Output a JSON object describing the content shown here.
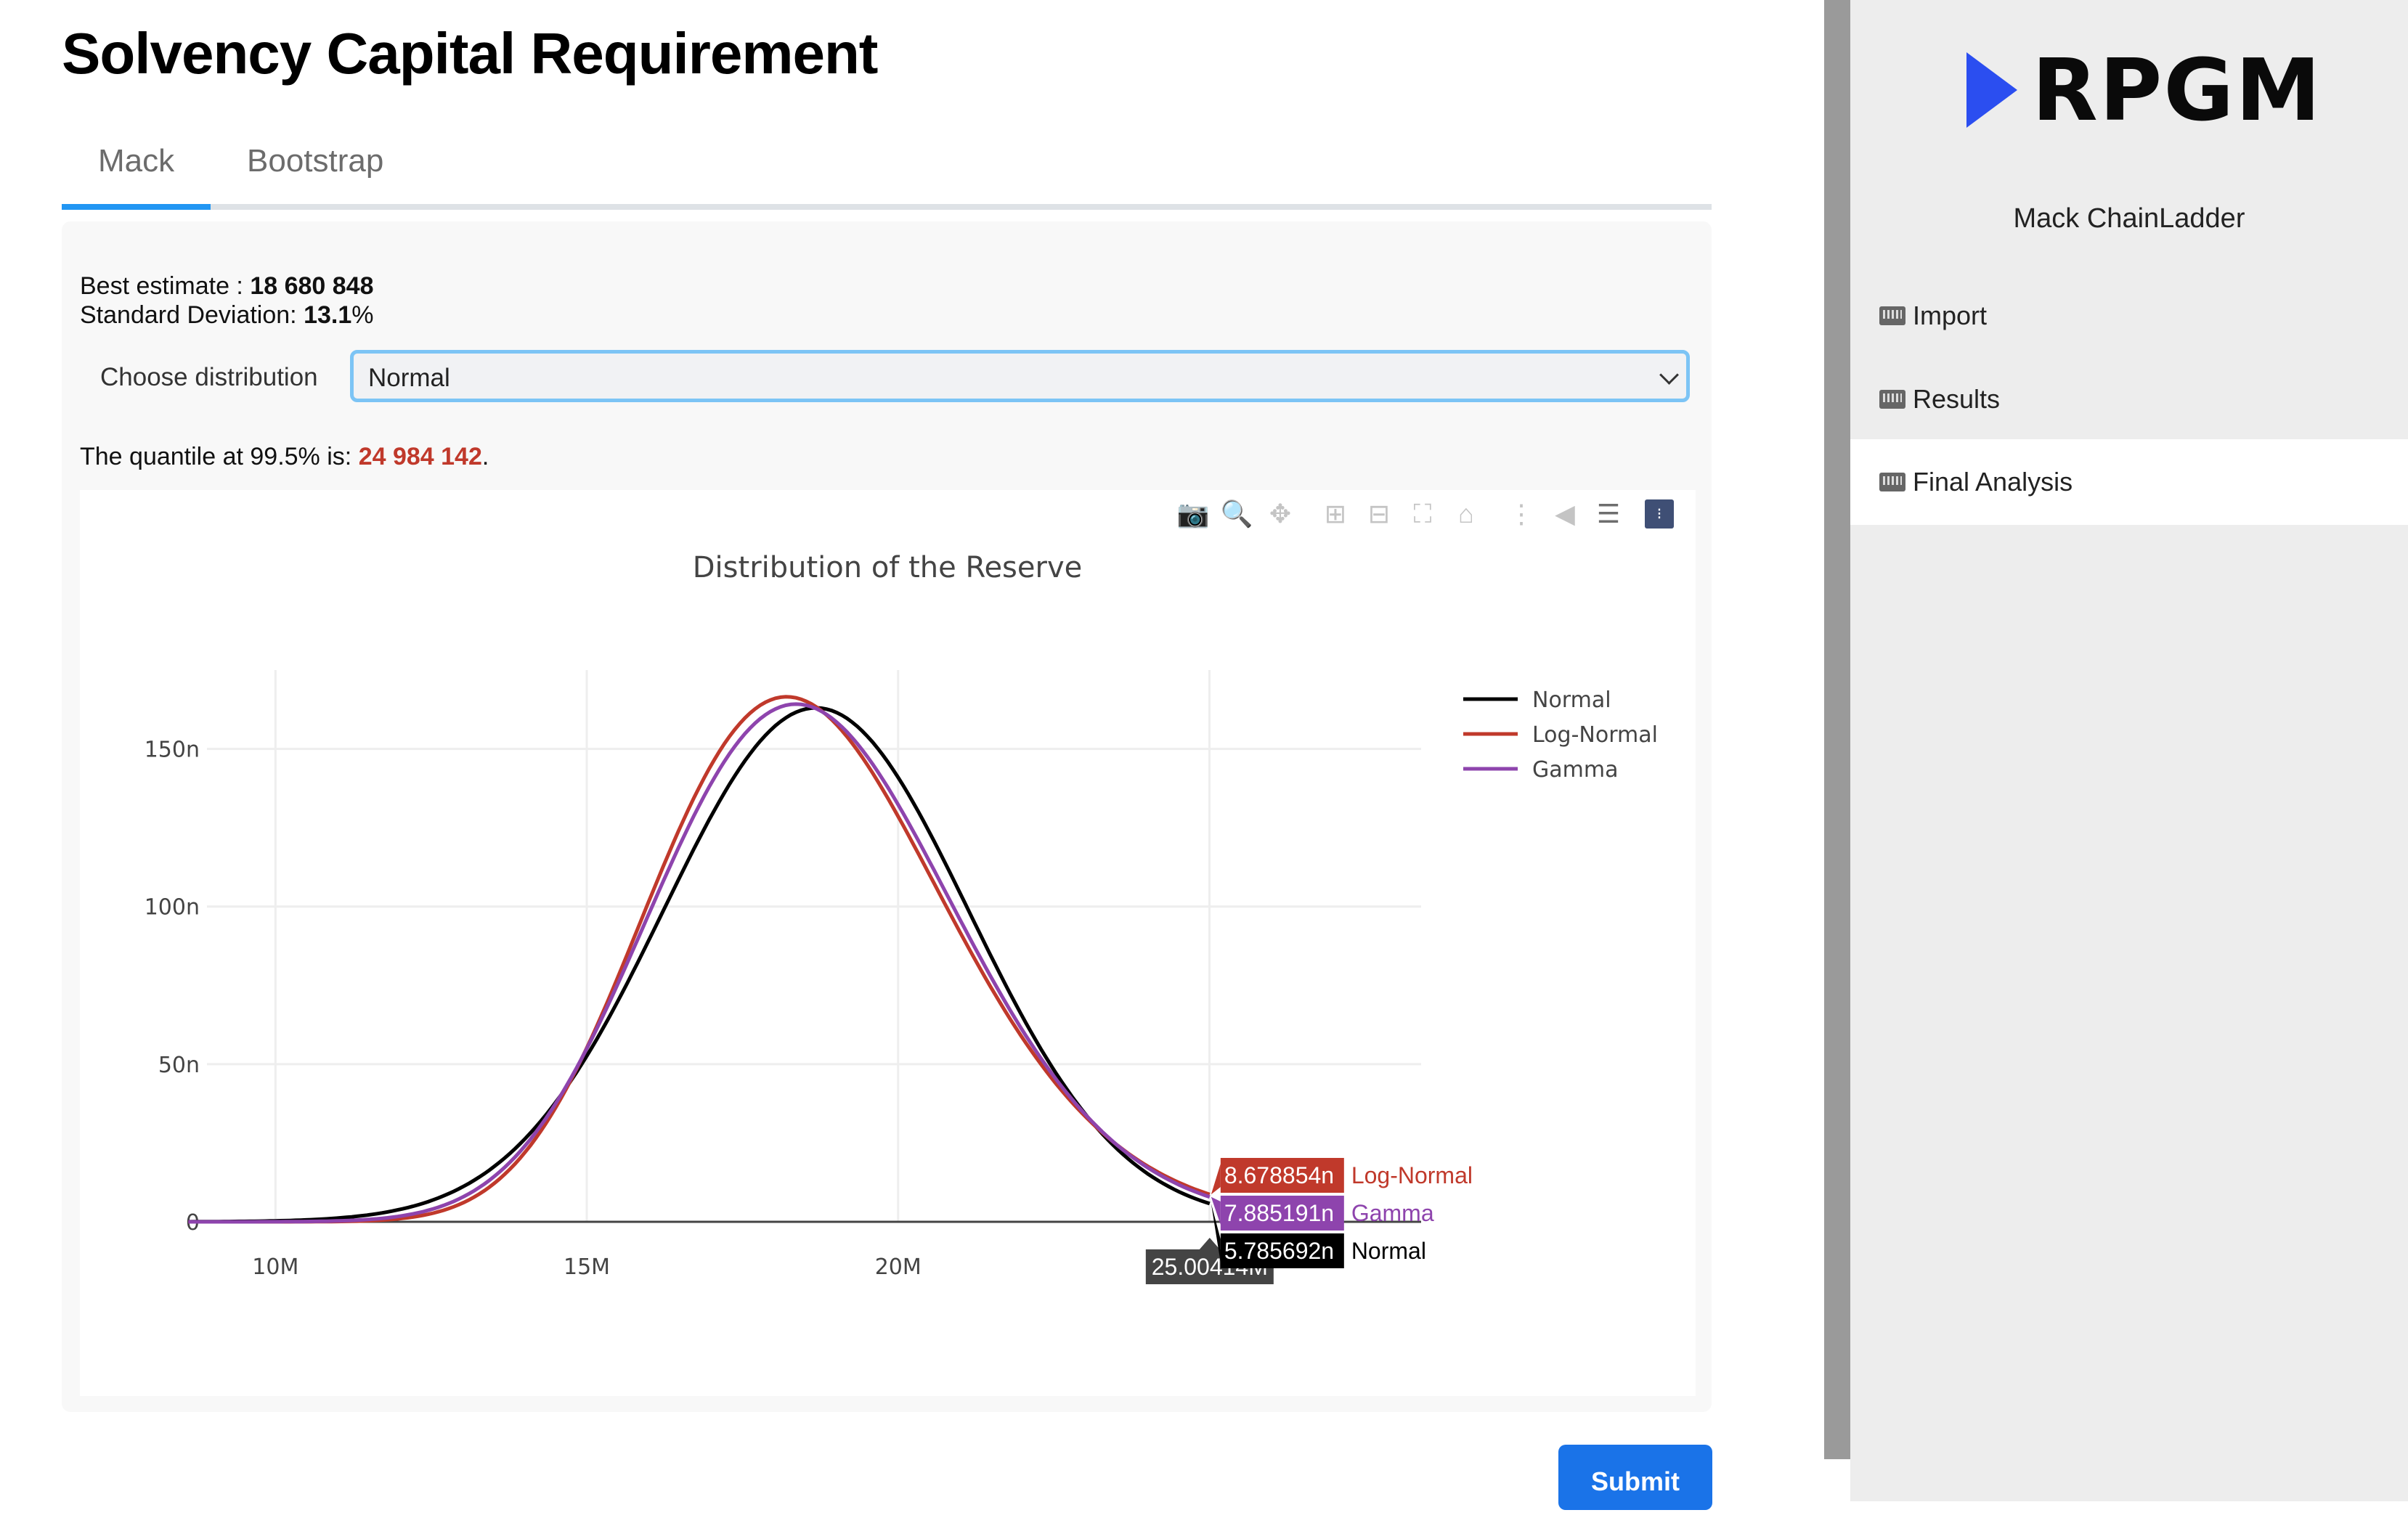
{
  "page": {
    "title": "Solvency Capital Requirement"
  },
  "tabs": [
    {
      "label": "Mack",
      "active": true
    },
    {
      "label": "Bootstrap",
      "active": false
    }
  ],
  "summary": {
    "best_estimate_label": "Best estimate : ",
    "best_estimate_value": "18 680 848",
    "std_label": "Standard Deviation: ",
    "std_value": "13.1",
    "std_suffix": "%",
    "quantile_label": "The quantile at 99.5% is: ",
    "quantile_value": "24 984 142",
    "quantile_suffix": "."
  },
  "distribution": {
    "label": "Choose distribution",
    "selected": "Normal"
  },
  "modebar": [
    "camera-icon",
    "zoom-icon",
    "pan-icon",
    "zoom-in-icon",
    "zoom-out-icon",
    "autoscale-icon",
    "reset-axes-icon",
    "spike-lines-icon",
    "hover-closest-icon",
    "hover-compare-icon",
    "plotly-logo-icon"
  ],
  "chart_data": {
    "type": "line",
    "title": "Distribution of the Reserve",
    "xlabel": "",
    "ylabel": "",
    "xlim": [
      8.9,
      28.4
    ],
    "ylim": [
      0,
      175
    ],
    "x_unit": "M",
    "y_unit": "n",
    "xticks": [
      {
        "v": 10,
        "label": "10M"
      },
      {
        "v": 15,
        "label": "15M"
      },
      {
        "v": 20,
        "label": "20M"
      },
      {
        "v": 25,
        "label": "25M"
      }
    ],
    "yticks": [
      {
        "v": 0,
        "label": "0"
      },
      {
        "v": 50,
        "label": "50n"
      },
      {
        "v": 100,
        "label": "100n"
      },
      {
        "v": 150,
        "label": "150n"
      }
    ],
    "grid": true,
    "legend": "top-right",
    "x_range_data": [
      8.6,
      25.00414
    ],
    "series": [
      {
        "name": "Normal",
        "color": "#000000",
        "dist": "normal",
        "mean": 18.680848,
        "sd_pct": 13.1
      },
      {
        "name": "Log-Normal",
        "color": "#c0392b",
        "dist": "lognormal",
        "mean": 18.680848,
        "sd_pct": 13.1
      },
      {
        "name": "Gamma",
        "color": "#8e44ad",
        "dist": "gamma",
        "mean": 18.680848,
        "sd_pct": 13.1
      }
    ],
    "hover": {
      "x_label": "25.00414M",
      "items": [
        {
          "value": "8.678854n",
          "name": "Log-Normal",
          "color": "#c0392b"
        },
        {
          "value": "7.885191n",
          "name": "Gamma",
          "color": "#8e44ad"
        },
        {
          "value": "5.785692n",
          "name": "Normal",
          "color": "#000000"
        }
      ]
    }
  },
  "sidebar": {
    "brand": "RPGM",
    "app_name": "Mack ChainLadder",
    "items": [
      {
        "label": "Import",
        "icon": "keyboard-icon",
        "active": false
      },
      {
        "label": "Results",
        "icon": "keyboard-icon",
        "active": false
      },
      {
        "label": "Final Analysis",
        "icon": "keyboard-icon",
        "active": true
      }
    ]
  },
  "actions": {
    "submit_label": "Submit"
  }
}
